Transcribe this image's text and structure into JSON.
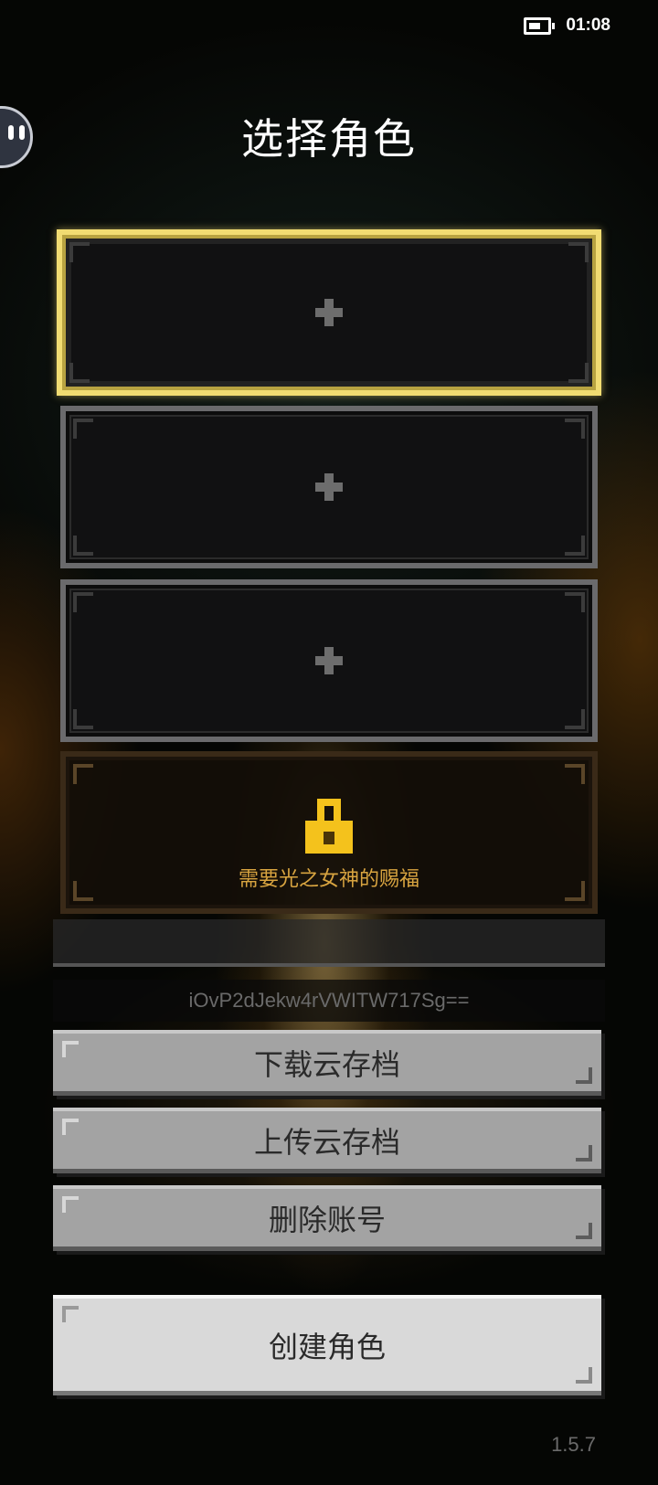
{
  "status_bar": {
    "time": "01:08"
  },
  "header": {
    "title": "选择角色"
  },
  "slots": [
    {
      "state": "empty",
      "selected": true
    },
    {
      "state": "empty",
      "selected": false
    },
    {
      "state": "empty",
      "selected": false
    },
    {
      "state": "locked",
      "lock_text": "需要光之女神的赐福"
    }
  ],
  "account": {
    "id": "iOvP2dJekw4rVWITW717Sg=="
  },
  "buttons": {
    "download": "下载云存档",
    "upload": "上传云存档",
    "delete": "删除账号",
    "create": "创建角色"
  },
  "version": "1.5.7",
  "colors": {
    "accent_gold": "#f1dc72",
    "lock_yellow": "#f4c21c",
    "lock_text": "#d8a440"
  }
}
